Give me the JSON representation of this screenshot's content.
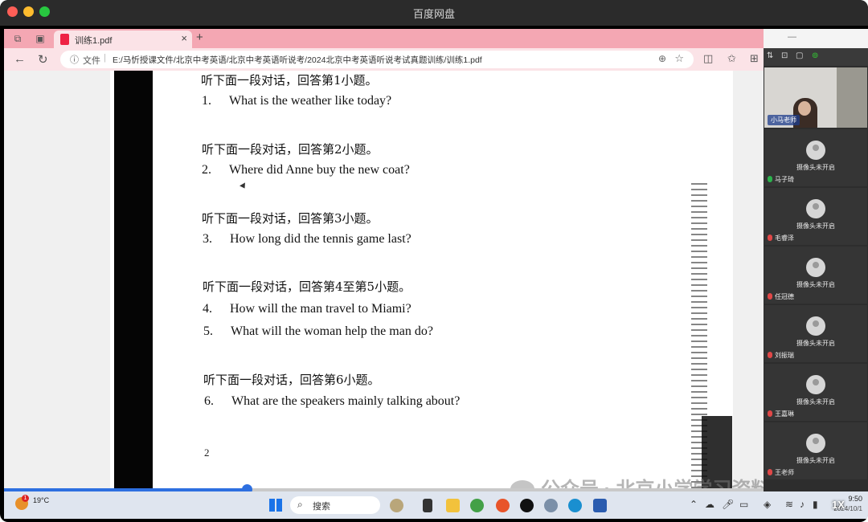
{
  "window": {
    "title": "百度网盘"
  },
  "browser": {
    "tab_label": "训练1.pdf",
    "address_label": "文件",
    "url": "E:/马忻授课文件/北京中考英语/北京中考英语听说考/2024北京中考英语听说考试真题训练/训练1.pdf"
  },
  "pdf": {
    "questions": [
      {
        "heading": "听下面一段对话，回答第1小题。",
        "items": [
          {
            "num": "1.",
            "text": "What is the weather like today?"
          }
        ]
      },
      {
        "heading": "听下面一段对话，回答第2小题。",
        "items": [
          {
            "num": "2.",
            "text": "Where did Anne buy the new coat?"
          }
        ]
      },
      {
        "heading": "听下面一段对话，回答第3小题。",
        "items": [
          {
            "num": "3.",
            "text": "How long did the tennis game last?"
          }
        ]
      },
      {
        "heading": "听下面一段对话，回答第4至第5小题。",
        "items": [
          {
            "num": "4.",
            "text": "How will the man travel to Miami?"
          },
          {
            "num": "5.",
            "text": "What will the woman help the man do?"
          }
        ]
      },
      {
        "heading": "听下面一段对话，回答第6小题。",
        "items": [
          {
            "num": "6.",
            "text": "What are the speakers mainly talking about?"
          }
        ]
      }
    ],
    "page_number": "2"
  },
  "player": {
    "progress": 0.32,
    "speed": "1X"
  },
  "taskbar": {
    "weather_temp": "19°C",
    "weather_badge": "1",
    "search_label": "搜索",
    "time": "9:50",
    "date": "2024/10/1"
  },
  "watermark": {
    "text": "公众号 · 北京小学学习资料"
  },
  "meeting": {
    "host": {
      "name": "小马老师"
    },
    "participants": [
      {
        "name": "马子琦",
        "status": "摄像头未开启",
        "mic": "on"
      },
      {
        "name": "毛睿泽",
        "status": "摄像头未开启",
        "mic": "off"
      },
      {
        "name": "任冠德",
        "status": "摄像头未开启",
        "mic": "off"
      },
      {
        "name": "刘振瑞",
        "status": "摄像头未开启",
        "mic": "off"
      },
      {
        "name": "王嘉琳",
        "status": "摄像头未开启",
        "mic": "off"
      },
      {
        "name": "王老师",
        "status": "摄像头未开启",
        "mic": "off"
      }
    ]
  }
}
